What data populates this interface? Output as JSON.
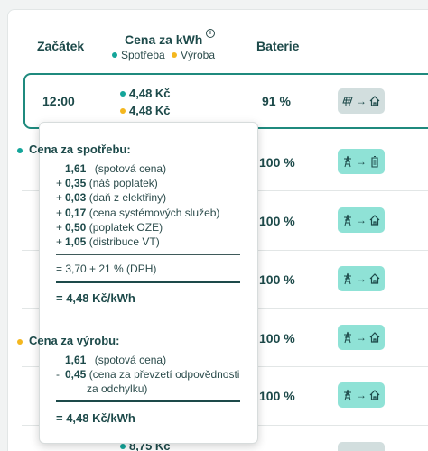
{
  "header": {
    "col_start": "Začátek",
    "col_price": "Cena za kWh",
    "legend_consumption": "Spotřeba",
    "legend_production": "Výroba",
    "col_battery": "Baterie",
    "info_icon": "i"
  },
  "colors": {
    "consumption": "#14a59a",
    "production": "#f4b71f",
    "accent": "#1f8a7e",
    "badge_active": "#8fe2d6",
    "badge_idle": "#d2dede"
  },
  "rows": [
    {
      "time": "12:00",
      "price_consumption": "4,48 Kč",
      "price_production": "4,48 Kč",
      "battery": "91 %",
      "icon_from": "solar-panel-icon",
      "icon_to": "home-icon"
    },
    {
      "battery": "100 %",
      "icon_from": "power-pylon-icon",
      "icon_to": "battery-icon"
    },
    {
      "battery": "100 %",
      "icon_from": "power-pylon-icon",
      "icon_to": "home-icon"
    },
    {
      "battery": "100 %",
      "icon_from": "power-pylon-icon",
      "icon_to": "home-icon"
    },
    {
      "battery": "100 %",
      "icon_from": "power-pylon-icon",
      "icon_to": "home-icon"
    },
    {
      "battery": "100 %",
      "icon_from": "power-pylon-icon",
      "icon_to": "home-icon"
    },
    {
      "price_partial": "8,75 Kč"
    }
  ],
  "tooltip": {
    "consumption": {
      "title": "Cena za spotřebu:",
      "items": [
        {
          "sign": "",
          "value": "1,61",
          "label": "(spotová cena)"
        },
        {
          "sign": "+",
          "value": "0,35",
          "label": "(náš poplatek)"
        },
        {
          "sign": "+",
          "value": "0,03",
          "label": "(daň z elektřiny)"
        },
        {
          "sign": "+",
          "value": "0,17",
          "label": "(cena systémových služeb)"
        },
        {
          "sign": "+",
          "value": "0,50",
          "label": "(poplatek OZE)"
        },
        {
          "sign": "+",
          "value": "1,05",
          "label": "(distribuce VT)"
        }
      ],
      "subtotal": "= 3,70 + 21 % (DPH)",
      "total": "= 4,48 Kč/kWh"
    },
    "production": {
      "title": "Cena za výrobu:",
      "items": [
        {
          "sign": "",
          "value": "1,61",
          "label": "(spotová cena)"
        },
        {
          "sign": "-",
          "value": "0,45",
          "label": "(cena za převzetí odpovědnosti"
        }
      ],
      "items_cont": "za odchylku)",
      "total": "= 4,48 Kč/kWh"
    }
  }
}
